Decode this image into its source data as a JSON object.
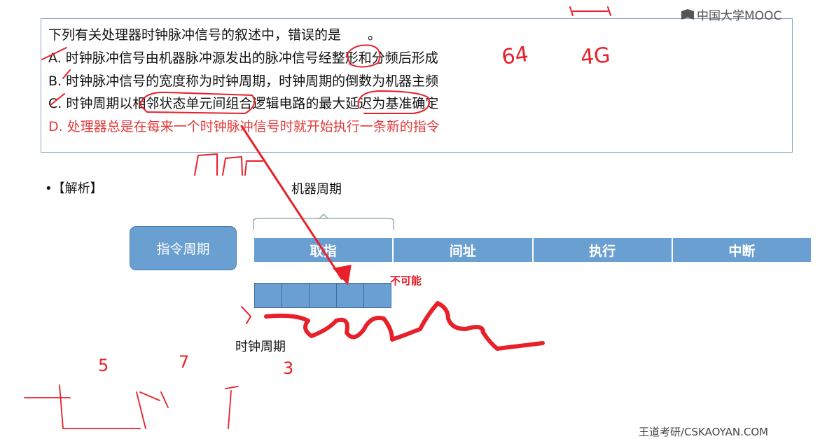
{
  "question": {
    "title": "下列有关处理器时钟脉冲信号的叙述中，错误的是　　。",
    "option_a": "A. 时钟脉冲信号由机器脉冲源发出的脉冲信号经整形和分频后形成",
    "option_b": "B. 时钟脉冲信号的宽度称为时钟周期，时钟周期的倒数为机器主频",
    "option_c": "C. 时钟周期以相邻状态单元间组合逻辑电路的最大延迟为基准确定",
    "option_d": "D. 处理器总是在每来一个时钟脉冲信号时就开始执行一条新的指令"
  },
  "watermark": "中国大学MOOC",
  "analysis_label": "•【解析】",
  "diagram": {
    "machine_cycle_label": "机器周期",
    "instruction_cycle": "指令周期",
    "phases": [
      "取指",
      "间址",
      "执行",
      "中断"
    ],
    "clock_cells": 5,
    "clock_cycle_label": "时钟周期",
    "impossible_note": "不可能"
  },
  "annotations": {
    "num_64": "64",
    "num_4g": "4G",
    "num_5": "5",
    "num_7": "7",
    "num_3": "3"
  },
  "footer": "王道考研/CSKAOYAN.COM",
  "colors": {
    "accent_blue": "#6a9fd1",
    "ink_red": "#e8202a",
    "option_d_red": "#e33a3a"
  }
}
